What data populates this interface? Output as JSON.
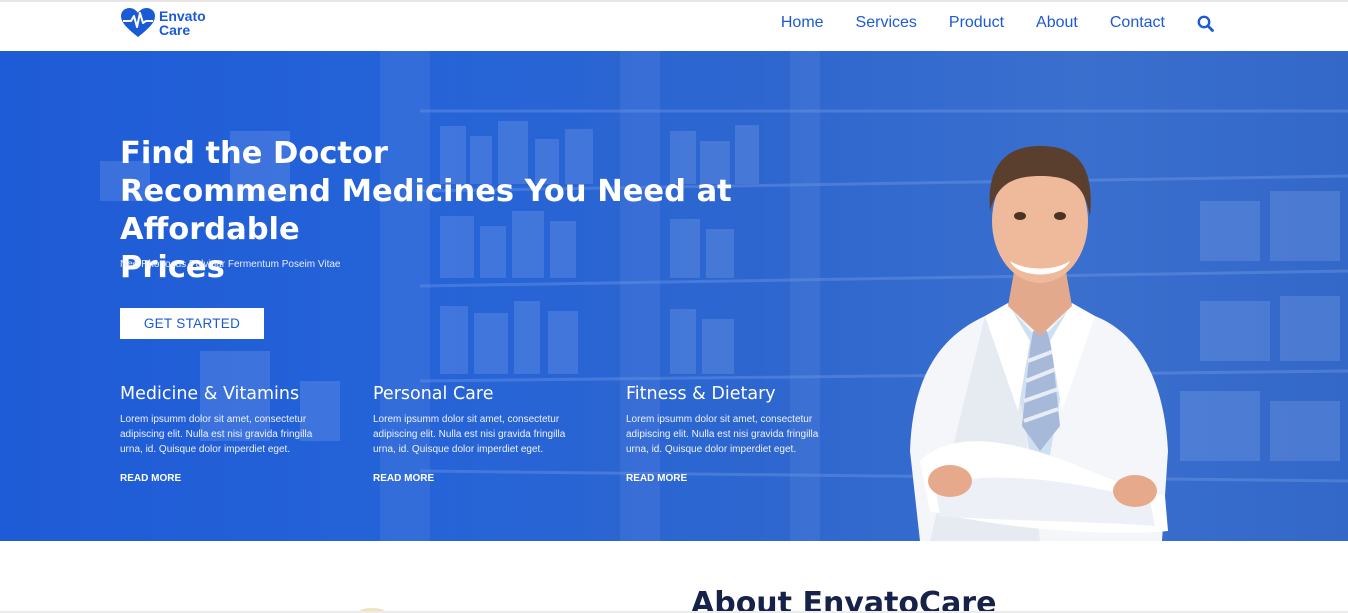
{
  "brand": {
    "line1": "Envato",
    "line2": "Care",
    "color": "#1b5ad6"
  },
  "nav": {
    "items": [
      "Home",
      "Services",
      "Product",
      "About",
      "Contact"
    ],
    "search_icon": "search-icon"
  },
  "hero": {
    "title_line1": "Find the Doctor",
    "title_line2": "Recommend Medicines You Need at Affordable",
    "title_line3": "Prices",
    "subtitle": "Nee Rhonocus Pulvinar Fermentum Poseim Vitae",
    "cta_label": "GET STARTED",
    "background_color": "#1e5bd6"
  },
  "features": [
    {
      "title": "Medicine & Vitamins",
      "text": "Lorem ipsumm dolor sit amet, consectetur adipiscing elit. Nulla est nisi gravida fringilla urna, id. Quisque dolor imperdiet eget.",
      "link": "READ MORE"
    },
    {
      "title": "Personal Care",
      "text": "Lorem ipsumm dolor sit amet, consectetur adipiscing elit. Nulla est nisi gravida fringilla urna, id. Quisque dolor imperdiet eget.",
      "link": "READ MORE"
    },
    {
      "title": "Fitness & Dietary",
      "text": "Lorem ipsumm dolor sit amet, consectetur adipiscing elit. Nulla est nisi gravida fringilla urna, id. Quisque dolor imperdiet eget.",
      "link": "READ MORE"
    }
  ],
  "about": {
    "title": "About EnvatoCare"
  }
}
